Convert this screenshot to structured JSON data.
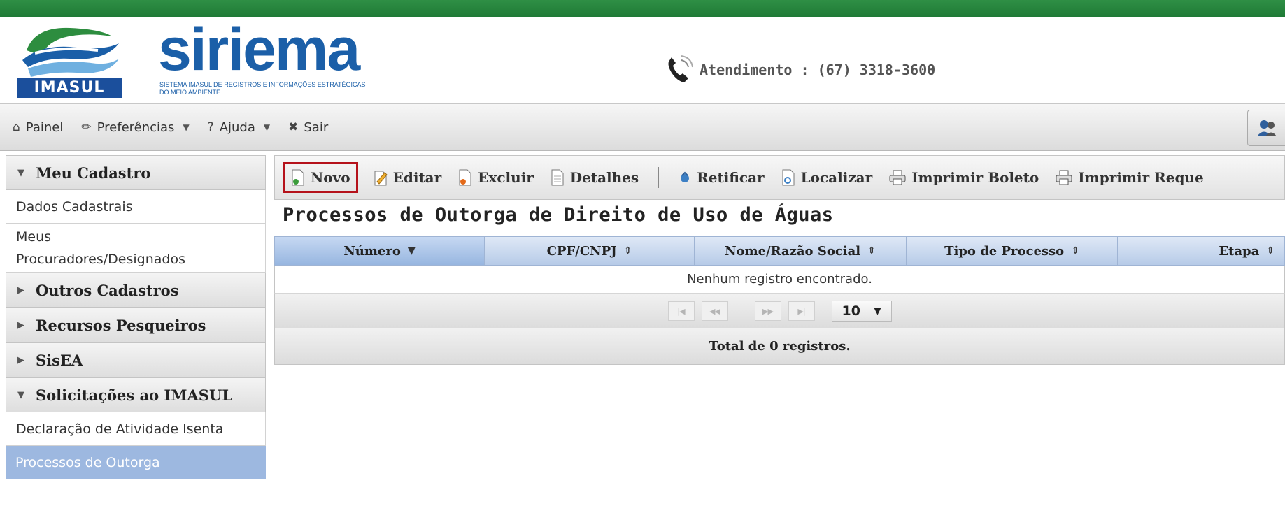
{
  "header": {
    "logo_text": "IMASUL",
    "brand": "siriema",
    "brand_sub": "SISTEMA IMASUL DE REGISTROS E INFORMAÇÕES ESTRATÉGICAS DO MEIO AMBIENTE",
    "contact": "Atendimento : (67) 3318-3600"
  },
  "menubar": {
    "items": [
      {
        "label": "Painel",
        "icon": "home-icon"
      },
      {
        "label": "Preferências",
        "icon": "wrench-icon"
      },
      {
        "label": "Ajuda",
        "icon": "question-icon"
      },
      {
        "label": "Sair",
        "icon": "close-icon"
      }
    ]
  },
  "sidebar": {
    "items": [
      {
        "label": "Meu Cadastro",
        "type": "section",
        "expanded": true
      },
      {
        "label": "Dados Cadastrais",
        "type": "link"
      },
      {
        "label": "Meus Procuradores/Designados",
        "type": "link"
      },
      {
        "label": "Outros Cadastros",
        "type": "section",
        "expanded": false
      },
      {
        "label": "Recursos Pesqueiros",
        "type": "section",
        "expanded": false
      },
      {
        "label": "SisEA",
        "type": "section",
        "expanded": false
      },
      {
        "label": "Solicitações ao IMASUL",
        "type": "section",
        "expanded": true
      },
      {
        "label": "Declaração de Atividade Isenta",
        "type": "link"
      },
      {
        "label": "Processos de Outorga",
        "type": "link",
        "active": true
      }
    ]
  },
  "toolbar": {
    "novo": "Novo",
    "editar": "Editar",
    "excluir": "Excluir",
    "detalhes": "Detalhes",
    "retificar": "Retificar",
    "localizar": "Localizar",
    "imprimir_boleto": "Imprimir Boleto",
    "imprimir_req": "Imprimir Reque"
  },
  "main": {
    "title": "Processos de Outorga de Direito de Uso de Águas",
    "columns": [
      "Número",
      "CPF/CNPJ",
      "Nome/Razão Social",
      "Tipo de Processo",
      "Etapa"
    ],
    "empty_message": "Nenhum registro encontrado.",
    "rows_per_page": "10",
    "total": "Total de 0 registros."
  },
  "colors": {
    "stripe": "#1f7a36",
    "brand": "#1b5fa8",
    "active_item": "#9db8e0",
    "highlight_border": "#b5121b"
  }
}
